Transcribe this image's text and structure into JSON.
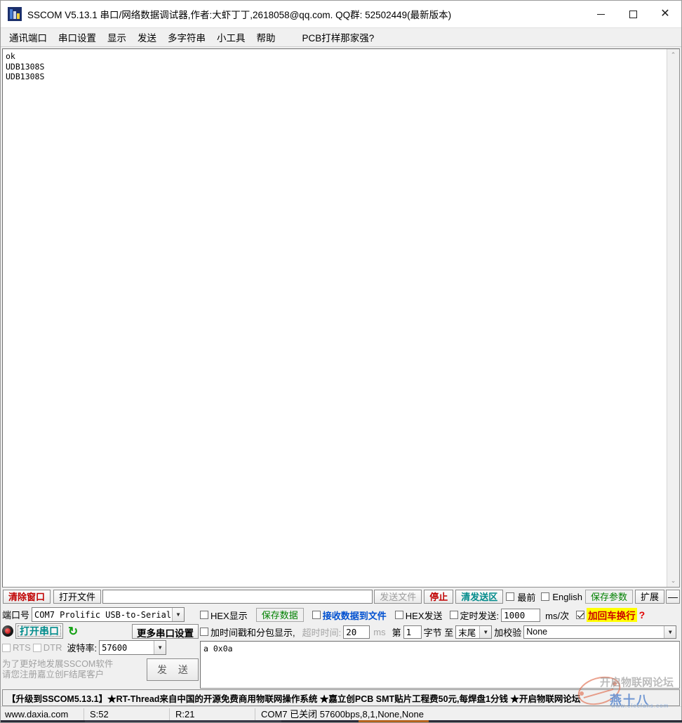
{
  "window": {
    "title": "SSCOM V5.13.1 串口/网络数据调试器,作者:大虾丁丁,2618058@qq.com. QQ群: 52502449(最新版本)",
    "icon": "sscom-app-icon",
    "minimize": "–",
    "maximize": "□",
    "close": "✕"
  },
  "menu": {
    "items": [
      {
        "label": "通讯端口",
        "name": "menu-comm-port"
      },
      {
        "label": "串口设置",
        "name": "menu-serial-settings"
      },
      {
        "label": "显示",
        "name": "menu-display"
      },
      {
        "label": "发送",
        "name": "menu-send"
      },
      {
        "label": "多字符串",
        "name": "menu-multi-string"
      },
      {
        "label": "小工具",
        "name": "menu-tools"
      },
      {
        "label": "帮助",
        "name": "menu-help"
      },
      {
        "label": "PCB打样那家强?",
        "name": "menu-pcb-ad"
      }
    ]
  },
  "receive": {
    "text": "ok\nUDB1308S\nUDB1308S",
    "scroll_up": "⌃",
    "scroll_down": "⌄"
  },
  "sendbar": {
    "clear_window": "清除窗口",
    "open_file": "打开文件",
    "file_path": "",
    "file_path_placeholder": "",
    "send_file": "发送文件",
    "stop": "停止",
    "clear_send": "清发送区",
    "topmost_label": "最前",
    "topmost_checked": false,
    "english_label": "English",
    "english_checked": false,
    "save_params": "保存参数",
    "extend": "扩展",
    "collapse": "—"
  },
  "port_settings": {
    "port_label": "端口号",
    "port_value": "COM7 Prolific USB-to-Serial",
    "open_port_button": "打开串口",
    "refresh_icon": "↻",
    "more_settings": "更多串口设置",
    "rts_label": "RTS",
    "rts_checked": false,
    "dtr_label": "DTR",
    "dtr_checked": false,
    "baud_label": "波特率:",
    "baud_value": "57600",
    "register_notice": "为了更好地发展SSCOM软件\n请您注册嘉立创F结尾客户",
    "send_button": "发 送"
  },
  "recv_options": {
    "hex_display_label": "HEX显示",
    "hex_display_checked": false,
    "save_data": "保存数据",
    "recv_to_file_label": "接收数据到文件",
    "recv_to_file_checked": false,
    "timestamp_label": "加时间戳和分包显示,",
    "timestamp_checked": false,
    "timeout_label": "超时时间:",
    "timeout_value": "20",
    "timeout_unit": "ms",
    "byte_prefix": "第",
    "byte_index": "1",
    "byte_mid": "字节 至",
    "byte_end": "末尾",
    "checksum_label": "加校验",
    "checksum_value": "None"
  },
  "send_options": {
    "hex_send_label": "HEX发送",
    "hex_send_checked": false,
    "timed_send_label": "定时发送:",
    "timed_send_checked": false,
    "interval_value": "1000",
    "interval_unit": "ms/次",
    "crlf_label": "加回车换行",
    "crlf_checked": true,
    "help_icon": "?",
    "send_text": "a 0x0a"
  },
  "marquee": {
    "text": "【升级到SSCOM5.13.1】★RT-Thread来自中国的开源免费商用物联网操作系统 ★嘉立创PCB SMT贴片工程费50元,每焊盘1分钱 ★开启物联网论坛"
  },
  "statusbar": {
    "website": "www.daxia.com",
    "sent": "S:52",
    "received": "R:21",
    "connection": "COM7 已关闭  57600bps,8,1,None,None"
  },
  "watermark": {
    "brand": "燕十八",
    "sub": "www.elecfans.com",
    "overlay_text": "开启物联网论坛"
  },
  "colors": {
    "accent_red": "#c00000",
    "accent_green": "#008000",
    "accent_teal": "#008b8b",
    "accent_blue": "#0050d0",
    "highlight_yellow": "#ffff00",
    "panel_bg": "#f0f0f0"
  }
}
